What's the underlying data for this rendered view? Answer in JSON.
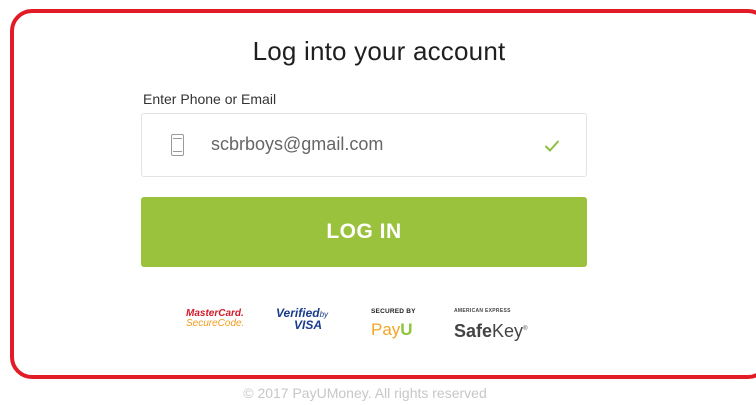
{
  "login": {
    "title": "Log into your account",
    "field_label": "Enter Phone or Email",
    "field_value": "scbrboys@gmail.com",
    "button_label": "LOG IN",
    "accent_color": "#9ac23c",
    "highlight_border_color": "#e21c26"
  },
  "badges": {
    "mastercard_line1": "MasterCard.",
    "mastercard_line2": "SecureCode.",
    "visa_line1_a": "Verified",
    "visa_line1_b": "by",
    "visa_line2": "VISA",
    "payu_line1": "SECURED BY",
    "payu_line2_a": "Pay",
    "payu_line2_b": "U",
    "amex_line1": "AMERICAN EXPRESS",
    "amex_line2_a": "Safe",
    "amex_line2_b": "Key",
    "amex_tm": "®"
  },
  "footer": {
    "copyright": "© 2017 PayUMoney. All rights reserved"
  },
  "icons": {
    "field_icon": "phone-icon",
    "valid_icon": "checkmark-icon"
  }
}
